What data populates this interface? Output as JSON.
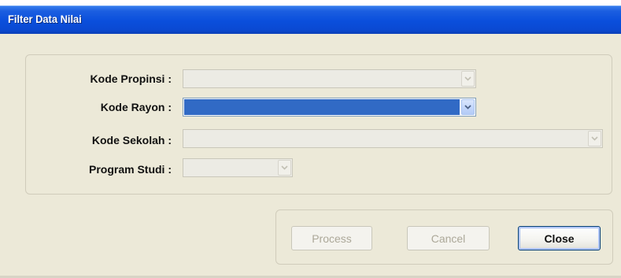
{
  "window": {
    "title": "Filter Data Nilai"
  },
  "filters": {
    "propinsi": {
      "label": "Kode Propinsi :",
      "value": "",
      "enabled": false
    },
    "rayon": {
      "label": "Kode Rayon :",
      "value": "",
      "enabled": true,
      "selected": true
    },
    "sekolah": {
      "label": "Kode Sekolah :",
      "value": "",
      "enabled": false
    },
    "studi": {
      "label": "Program Studi :",
      "value": "",
      "enabled": false
    }
  },
  "buttons": {
    "process": {
      "label": "Process",
      "enabled": false
    },
    "cancel": {
      "label": "Cancel",
      "enabled": false
    },
    "close": {
      "label": "Close",
      "enabled": true,
      "default": true
    }
  },
  "icons": {
    "dropdown": "chevron-down-icon"
  },
  "colors": {
    "titlebar": "#0a4fdc",
    "dialog_bg": "#ece9d8",
    "selection": "#316ac5",
    "disabled_text": "#aca899"
  }
}
